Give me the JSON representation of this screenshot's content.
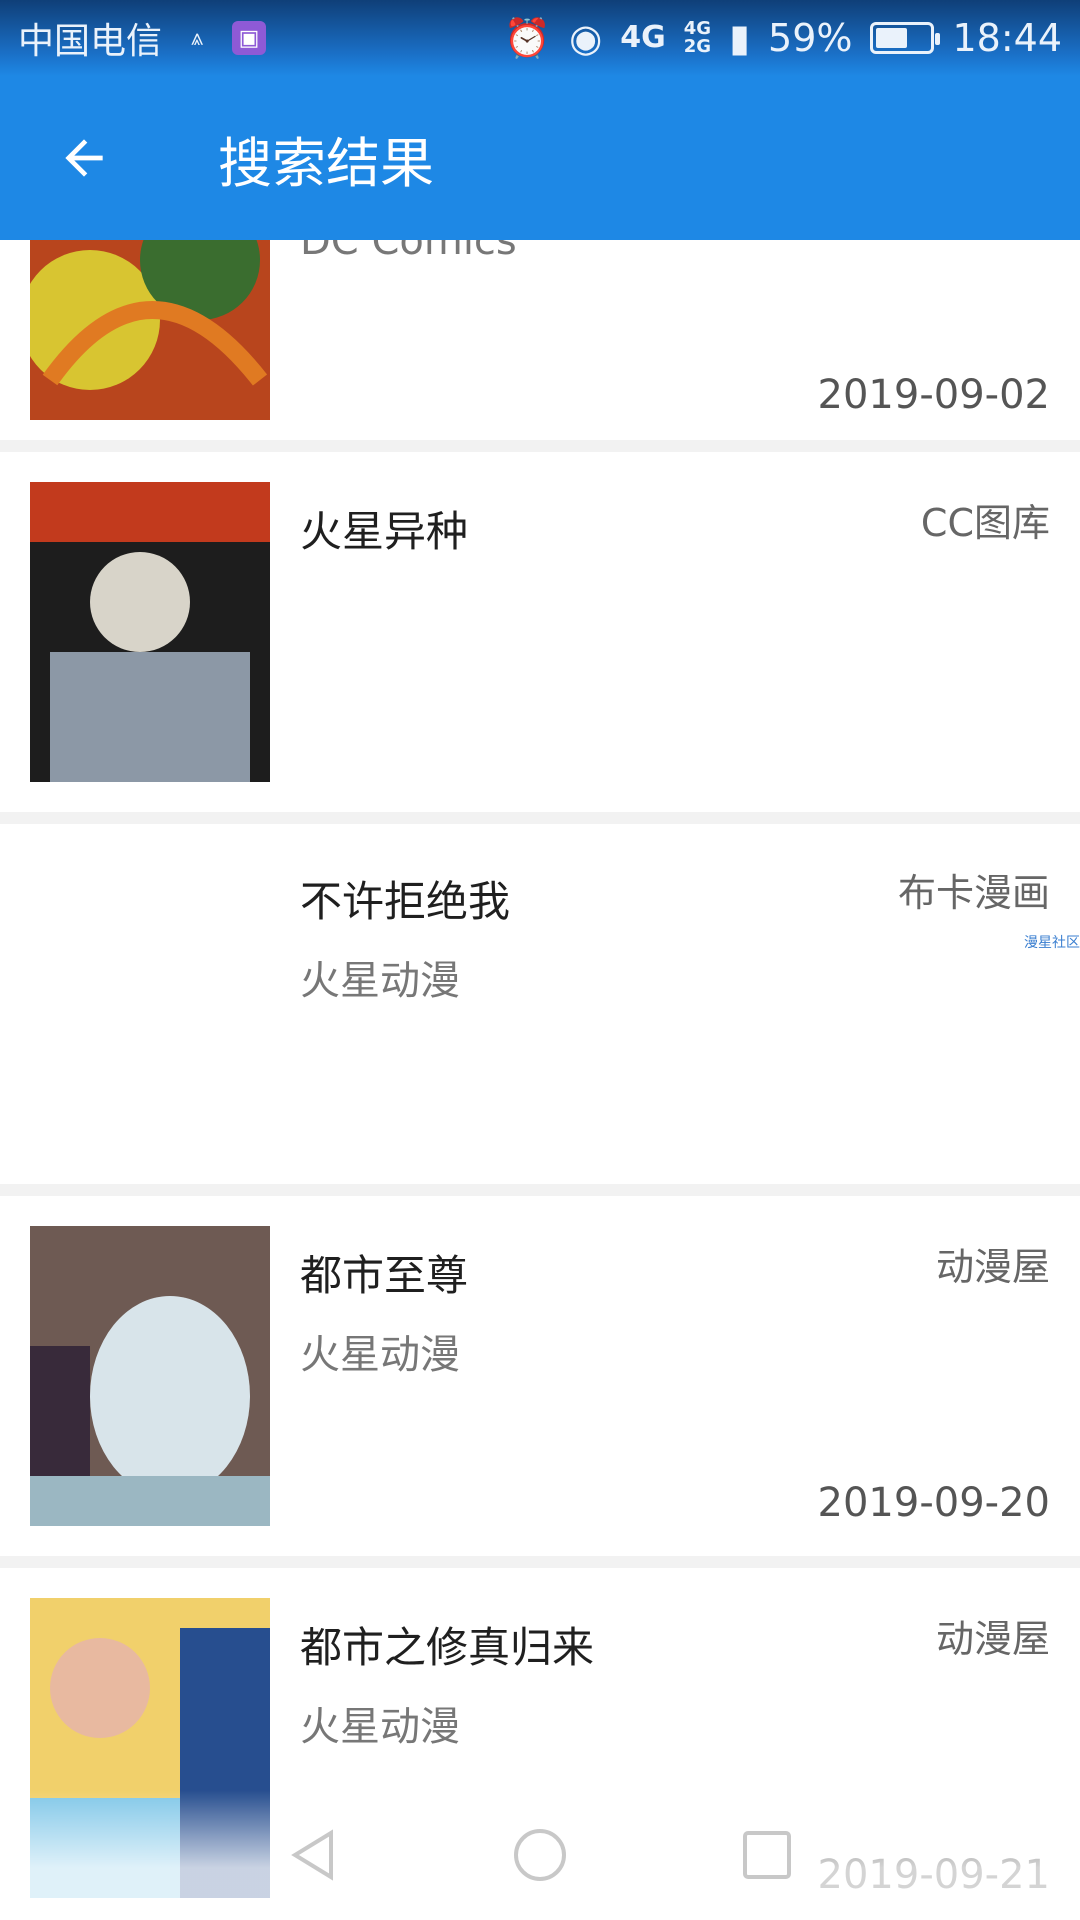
{
  "status_bar": {
    "carrier": "中国电信",
    "network_main": "4G",
    "network_top": "4G",
    "network_bottom": "2G",
    "battery_percent": "59%",
    "battery_level": 0.59,
    "time": "18:44"
  },
  "app_bar": {
    "title": "搜索结果"
  },
  "results": [
    {
      "title": "",
      "author": "DC Comics",
      "source": "",
      "date": "2019-09-02",
      "cover_colors": [
        "#b8451d",
        "#d8c531",
        "#3a6d2f",
        "#e07a22"
      ]
    },
    {
      "title": "火星异种",
      "author": "",
      "source": "CC图库",
      "date": "",
      "cover_colors": [
        "#1d1d1d",
        "#c23a1d",
        "#d8d4c9",
        "#8c98a6"
      ]
    },
    {
      "title": "不许拒绝我",
      "author": "火星动漫",
      "source": "布卡漫画",
      "date": "",
      "watermark": "漫星社区"
    },
    {
      "title": "都市至尊",
      "author": "火星动漫",
      "source": "动漫屋",
      "date": "2019-09-20",
      "cover_colors": [
        "#6e5a53",
        "#d8e4ea",
        "#382a3a",
        "#9bb7c2"
      ]
    },
    {
      "title": "都市之修真归来",
      "author": "火星动漫",
      "source": "动漫屋",
      "date": "2019-09-21",
      "cover_colors": [
        "#f1d06b",
        "#274e8f",
        "#80c7e8",
        "#e8b9a0"
      ]
    }
  ],
  "colors": {
    "primary": "#1e88e5",
    "divider": "#f2f2f2"
  }
}
